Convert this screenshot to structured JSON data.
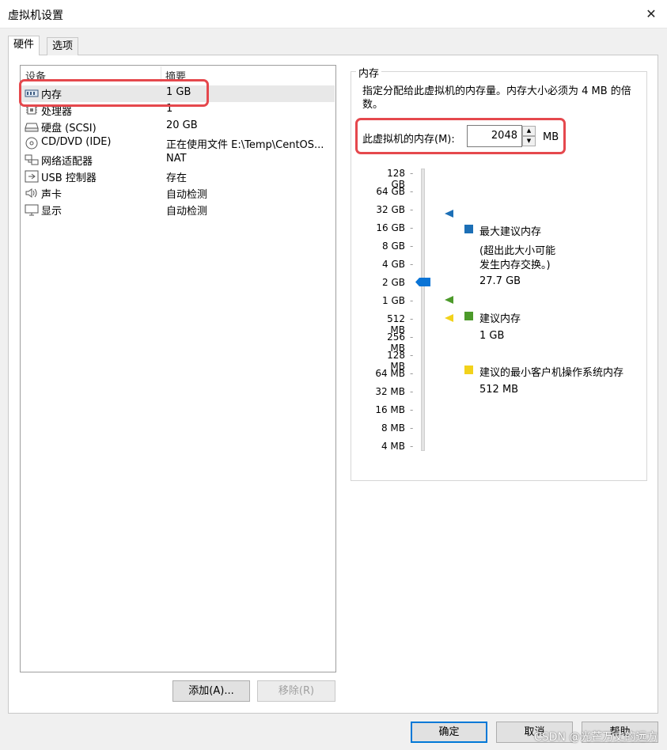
{
  "window": {
    "title": "虚拟机设置",
    "close_glyph": "✕"
  },
  "tabs": [
    {
      "label": "硬件"
    },
    {
      "label": "选项"
    }
  ],
  "device_list": {
    "headers": {
      "device": "设备",
      "summary": "摘要"
    },
    "rows": [
      {
        "name": "内存",
        "summary": "1 GB",
        "icon": "memory-icon"
      },
      {
        "name": "处理器",
        "summary": "1",
        "icon": "processor-icon"
      },
      {
        "name": "硬盘 (SCSI)",
        "summary": "20 GB",
        "icon": "hard-disk-icon"
      },
      {
        "name": "CD/DVD (IDE)",
        "summary": "正在使用文件 E:\\Temp\\CentOS...",
        "icon": "cd-dvd-icon"
      },
      {
        "name": "网络适配器",
        "summary": "NAT",
        "icon": "network-adapter-icon"
      },
      {
        "name": "USB 控制器",
        "summary": "存在",
        "icon": "usb-controller-icon"
      },
      {
        "name": "声卡",
        "summary": "自动检测",
        "icon": "sound-card-icon"
      },
      {
        "name": "显示",
        "summary": "自动检测",
        "icon": "display-icon"
      }
    ]
  },
  "list_buttons": {
    "add": "添加(A)...",
    "remove": "移除(R)"
  },
  "memory": {
    "group_title": "内存",
    "description": "指定分配给此虚拟机的内存量。内存大小必须为 4 MB 的倍数。",
    "field_label": "此虚拟机的内存(M):",
    "field_value": "2048",
    "unit": "MB",
    "spin_up": "▲",
    "spin_down": "▼",
    "scale_labels": [
      "128 GB",
      "64 GB",
      "32 GB",
      "16 GB",
      "8 GB",
      "4 GB",
      "2 GB",
      "1 GB",
      "512 MB",
      "256 MB",
      "128 MB",
      "64 MB",
      "32 MB",
      "16 MB",
      "8 MB",
      "4 MB"
    ],
    "tick_dash": "-",
    "legend": {
      "max": {
        "title": "最大建议内存",
        "note_line1": "(超出此大小可能",
        "note_line2": "发生内存交换。)",
        "value": "27.7 GB",
        "color": "#1c6fb6"
      },
      "recommended": {
        "title": "建议内存",
        "value": "1 GB",
        "color": "#4c9a2a"
      },
      "min_guest": {
        "title": "建议的最小客户机操作系统内存",
        "value": "512 MB",
        "color": "#f2d21b"
      }
    },
    "slider_color": "#0a74d6"
  },
  "dialog_buttons": {
    "ok": "确定",
    "cancel": "取消",
    "help": "帮助"
  },
  "watermark": "CSDN @光芒万丈的远方"
}
